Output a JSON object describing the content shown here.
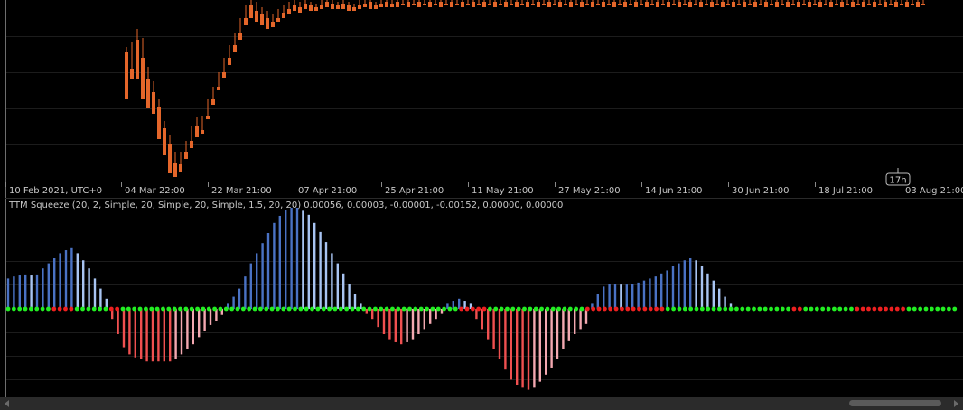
{
  "colors": {
    "background": "#000000",
    "bull_candle": "#1f8f2a",
    "bear_candle": "#e4662a",
    "hist_pos_rising": "#4a72c4",
    "hist_pos_falling": "#a8c4f2",
    "hist_neg_falling": "#f05050",
    "hist_neg_rising": "#f3a8b0",
    "squeeze_off": "#22ee22",
    "squeeze_on": "#ee2020",
    "grid": "#1c1c1c",
    "axis_line": "#8a8a8a"
  },
  "time_axis": {
    "labels": [
      "10 Feb 2021, UTC+0",
      "04 Mar 22:00",
      "22 Mar 21:00",
      "07 Apr 21:00",
      "25 Apr 21:00",
      "11 May 21:00",
      "27 May 21:00",
      "14 Jun 21:00",
      "30 Jun 21:00",
      "18 Jul 21:00",
      "03 Aug 21:00"
    ],
    "crosshair_badge": "17h"
  },
  "indicator": {
    "label": "TTM Squeeze (20, 2, Simple, 20, Simple, 20, Simple, 1.5, 20, 20) 0.00056, 0.00003, -0.00001, -0.00152, 0.00000, 0.00000"
  },
  "chart_data": [
    {
      "type": "candlestick",
      "candles": [
        [
          0.71,
          0.74,
          0.52,
          0.45
        ],
        [
          0.62,
          0.7,
          0.77,
          0.56
        ],
        [
          0.78,
          0.84,
          0.64,
          0.56
        ],
        [
          0.68,
          0.79,
          0.54,
          0.45
        ],
        [
          0.56,
          0.63,
          0.48,
          0.4
        ],
        [
          0.49,
          0.55,
          0.42,
          0.37
        ],
        [
          0.41,
          0.45,
          0.29,
          0.23
        ],
        [
          0.29,
          0.33,
          0.18,
          0.14
        ],
        [
          0.2,
          0.25,
          0.1,
          0.04
        ],
        [
          0.1,
          0.16,
          0.08,
          0.02
        ],
        [
          0.09,
          0.15,
          0.16,
          0.05
        ],
        [
          0.16,
          0.2,
          0.22,
          0.12
        ],
        [
          0.22,
          0.28,
          0.3,
          0.18
        ],
        [
          0.3,
          0.35,
          0.28,
          0.24
        ],
        [
          0.28,
          0.33,
          0.36,
          0.26
        ],
        [
          0.36,
          0.4,
          0.45,
          0.34
        ],
        [
          0.45,
          0.5,
          0.52,
          0.42
        ],
        [
          0.52,
          0.56,
          0.6,
          0.5
        ],
        [
          0.6,
          0.66,
          0.68,
          0.57
        ],
        [
          0.68,
          0.73,
          0.75,
          0.64
        ],
        [
          0.75,
          0.8,
          0.82,
          0.71
        ],
        [
          0.82,
          0.88,
          0.9,
          0.78
        ],
        [
          0.9,
          0.95,
          0.97,
          0.86
        ],
        [
          0.97,
          1.0,
          0.94,
          0.9
        ],
        [
          0.94,
          0.99,
          0.92,
          0.88
        ],
        [
          0.92,
          0.96,
          0.9,
          0.86
        ],
        [
          0.9,
          0.94,
          0.88,
          0.84
        ],
        [
          0.88,
          0.92,
          0.9,
          0.85
        ],
        [
          0.9,
          0.95,
          0.93,
          0.88
        ],
        [
          0.93,
          0.97,
          0.95,
          0.9
        ],
        [
          0.95,
          0.99,
          0.97,
          0.92
        ],
        [
          0.97,
          1.0,
          0.96,
          0.94
        ],
        [
          0.96,
          0.99,
          0.98,
          0.93
        ],
        [
          0.98,
          1.0,
          0.97,
          0.95
        ],
        [
          0.97,
          0.99,
          0.96,
          0.94
        ],
        [
          0.96,
          0.98,
          0.97,
          0.94
        ],
        [
          0.97,
          1.0,
          0.99,
          0.95
        ],
        [
          0.99,
          1.0,
          0.98,
          0.96
        ],
        [
          0.98,
          1.0,
          0.97,
          0.95
        ],
        [
          0.97,
          0.99,
          0.98,
          0.95
        ],
        [
          0.98,
          1.0,
          0.97,
          0.95
        ],
        [
          0.97,
          0.99,
          0.96,
          0.94
        ],
        [
          0.96,
          0.98,
          0.97,
          0.94
        ],
        [
          0.97,
          1.0,
          0.98,
          0.95
        ],
        [
          0.98,
          1.0,
          0.99,
          0.96
        ],
        [
          0.99,
          1.0,
          0.97,
          0.95
        ],
        [
          0.97,
          0.99,
          0.98,
          0.95
        ],
        [
          0.98,
          1.0,
          0.99,
          0.96
        ],
        [
          0.99,
          1.0,
          0.98,
          0.96
        ],
        [
          0.98,
          1.0,
          0.99,
          0.96
        ],
        [
          0.99,
          1.0,
          0.98,
          0.96
        ],
        [
          0.98,
          1.0,
          0.99,
          0.97
        ],
        [
          0.99,
          1.0,
          0.98,
          0.96
        ],
        [
          0.98,
          1.0,
          0.99,
          0.97
        ],
        [
          0.99,
          1.0,
          0.98,
          0.96
        ],
        [
          0.98,
          1.0,
          0.99,
          0.97
        ],
        [
          0.99,
          1.0,
          0.98,
          0.96
        ],
        [
          0.98,
          1.0,
          0.99,
          0.97
        ],
        [
          0.99,
          1.0,
          0.98,
          0.96
        ],
        [
          0.98,
          1.0,
          0.99,
          0.97
        ],
        [
          0.99,
          1.0,
          0.98,
          0.96
        ],
        [
          0.98,
          1.0,
          0.99,
          0.97
        ],
        [
          0.99,
          1.0,
          0.98,
          0.96
        ],
        [
          0.98,
          1.0,
          0.99,
          0.97
        ],
        [
          0.99,
          1.0,
          0.98,
          0.96
        ],
        [
          0.98,
          1.0,
          0.99,
          0.97
        ],
        [
          0.99,
          1.0,
          0.98,
          0.96
        ],
        [
          0.98,
          1.0,
          0.99,
          0.97
        ],
        [
          0.99,
          1.0,
          0.98,
          0.96
        ],
        [
          0.98,
          1.0,
          0.99,
          0.97
        ],
        [
          0.99,
          1.0,
          0.98,
          0.96
        ],
        [
          0.98,
          1.0,
          0.99,
          0.97
        ],
        [
          0.99,
          1.0,
          0.98,
          0.96
        ],
        [
          0.98,
          1.0,
          0.99,
          0.97
        ],
        [
          0.99,
          1.0,
          0.98,
          0.96
        ],
        [
          0.98,
          1.0,
          0.99,
          0.97
        ],
        [
          0.99,
          1.0,
          0.98,
          0.96
        ],
        [
          0.98,
          1.0,
          0.99,
          0.97
        ],
        [
          0.99,
          1.0,
          0.98,
          0.96
        ],
        [
          0.98,
          1.0,
          0.99,
          0.97
        ],
        [
          0.99,
          1.0,
          0.98,
          0.96
        ],
        [
          0.98,
          1.0,
          0.99,
          0.97
        ],
        [
          0.99,
          1.0,
          0.98,
          0.96
        ],
        [
          0.98,
          1.0,
          0.99,
          0.97
        ],
        [
          0.99,
          1.0,
          0.98,
          0.96
        ],
        [
          0.98,
          1.0,
          0.99,
          0.97
        ],
        [
          0.99,
          1.0,
          0.98,
          0.96
        ],
        [
          0.98,
          1.0,
          0.99,
          0.97
        ],
        [
          0.99,
          1.0,
          0.98,
          0.96
        ],
        [
          0.98,
          1.0,
          0.99,
          0.97
        ],
        [
          0.99,
          1.0,
          0.98,
          0.96
        ],
        [
          0.98,
          1.0,
          0.99,
          0.97
        ],
        [
          0.99,
          1.0,
          0.98,
          0.96
        ],
        [
          0.98,
          1.0,
          0.99,
          0.97
        ],
        [
          0.99,
          1.0,
          0.98,
          0.96
        ],
        [
          0.98,
          1.0,
          0.99,
          0.97
        ],
        [
          0.99,
          1.0,
          0.98,
          0.96
        ],
        [
          0.98,
          1.0,
          0.99,
          0.97
        ],
        [
          0.99,
          1.0,
          0.98,
          0.96
        ],
        [
          0.98,
          1.0,
          0.99,
          0.97
        ],
        [
          0.99,
          1.0,
          0.98,
          0.96
        ],
        [
          0.98,
          1.0,
          0.99,
          0.97
        ],
        [
          0.99,
          1.0,
          0.98,
          0.96
        ],
        [
          0.98,
          1.0,
          0.99,
          0.97
        ],
        [
          0.99,
          1.0,
          0.98,
          0.96
        ],
        [
          0.98,
          1.0,
          0.99,
          0.97
        ],
        [
          0.99,
          1.0,
          0.98,
          0.96
        ],
        [
          0.98,
          1.0,
          0.99,
          0.97
        ],
        [
          0.99,
          1.0,
          0.98,
          0.96
        ],
        [
          0.98,
          1.0,
          0.99,
          0.97
        ],
        [
          0.99,
          1.0,
          0.98,
          0.96
        ],
        [
          0.98,
          1.0,
          0.99,
          0.97
        ],
        [
          0.99,
          1.0,
          0.98,
          0.96
        ],
        [
          0.98,
          1.0,
          0.99,
          0.97
        ],
        [
          0.99,
          1.0,
          0.98,
          0.96
        ],
        [
          0.98,
          1.0,
          0.99,
          0.97
        ],
        [
          0.99,
          1.0,
          0.98,
          0.96
        ],
        [
          0.98,
          1.0,
          0.99,
          0.97
        ],
        [
          0.99,
          1.0,
          0.98,
          0.96
        ],
        [
          0.98,
          1.0,
          0.99,
          0.97
        ],
        [
          0.99,
          1.0,
          0.98,
          0.96
        ],
        [
          0.98,
          1.0,
          0.99,
          0.97
        ],
        [
          0.99,
          1.0,
          0.98,
          0.96
        ],
        [
          0.98,
          1.0,
          0.99,
          0.97
        ],
        [
          0.99,
          1.0,
          0.98,
          0.96
        ],
        [
          0.98,
          1.0,
          0.99,
          0.97
        ],
        [
          0.99,
          1.0,
          0.98,
          0.96
        ],
        [
          0.98,
          1.0,
          0.99,
          0.97
        ],
        [
          0.99,
          1.0,
          0.98,
          0.96
        ],
        [
          0.98,
          1.0,
          0.99,
          0.97
        ],
        [
          0.99,
          1.0,
          0.98,
          0.96
        ],
        [
          0.98,
          1.0,
          0.99,
          0.97
        ],
        [
          0.99,
          1.0,
          0.98,
          0.96
        ],
        [
          0.98,
          1.0,
          0.99,
          0.97
        ],
        [
          0.99,
          1.0,
          0.98,
          0.96
        ],
        [
          0.98,
          1.0,
          0.99,
          0.97
        ],
        [
          0.99,
          1.0,
          0.98,
          0.96
        ],
        [
          0.98,
          1.0,
          0.99,
          0.97
        ],
        [
          0.99,
          1.0,
          0.98,
          0.96
        ],
        [
          0.98,
          1.0,
          0.99,
          0.97
        ],
        [
          0.99,
          1.0,
          0.98,
          0.96
        ],
        [
          0.98,
          1.0,
          0.99,
          0.97
        ],
        [
          0.99,
          1.0,
          0.98,
          0.96
        ],
        [
          0.98,
          1.0,
          0.99,
          0.97
        ],
        [
          0.99,
          1.0,
          0.98,
          0.96
        ],
        [
          0.98,
          1.0,
          0.99,
          0.97
        ],
        [
          0.99,
          1.0,
          0.98,
          0.96
        ],
        [
          0.98,
          1.0,
          0.99,
          0.97
        ]
      ]
    },
    {
      "type": "bar",
      "series": [
        {
          "values": [
            0.3,
            0.32,
            0.33,
            0.34,
            0.33,
            0.34,
            0.4,
            0.45,
            0.5,
            0.55,
            0.58,
            0.6,
            0.55,
            0.48,
            0.4,
            0.3,
            0.2,
            0.1,
            -0.1,
            -0.25,
            -0.38,
            -0.45,
            -0.48,
            -0.5,
            -0.52,
            -0.52,
            -0.52,
            -0.52,
            -0.52,
            -0.5,
            -0.45,
            -0.4,
            -0.35,
            -0.28,
            -0.22,
            -0.16,
            -0.12,
            -0.06,
            0.05,
            0.12,
            0.2,
            0.32,
            0.45,
            0.55,
            0.65,
            0.75,
            0.85,
            0.92,
            0.98,
            1.0,
            1.0,
            0.97,
            0.93,
            0.85,
            0.76,
            0.66,
            0.55,
            0.45,
            0.35,
            0.25,
            0.15,
            0.05,
            -0.05,
            -0.1,
            -0.18,
            -0.25,
            -0.3,
            -0.33,
            -0.35,
            -0.33,
            -0.3,
            -0.25,
            -0.2,
            -0.15,
            -0.1,
            -0.05,
            0.05,
            0.08,
            0.1,
            0.08,
            0.05,
            -0.1,
            -0.2,
            -0.3,
            -0.4,
            -0.5,
            -0.6,
            -0.7,
            -0.75,
            -0.78,
            -0.8,
            -0.78,
            -0.72,
            -0.65,
            -0.58,
            -0.5,
            -0.4,
            -0.32,
            -0.25,
            -0.2,
            -0.15,
            0.05,
            0.15,
            0.22,
            0.25,
            0.25,
            0.24,
            0.24,
            0.25,
            0.26,
            0.28,
            0.3,
            0.32,
            0.35,
            0.38,
            0.42,
            0.45,
            0.48,
            0.5,
            0.48,
            0.42,
            0.35,
            0.28,
            0.2,
            0.12,
            0.05
          ]
        }
      ]
    }
  ]
}
